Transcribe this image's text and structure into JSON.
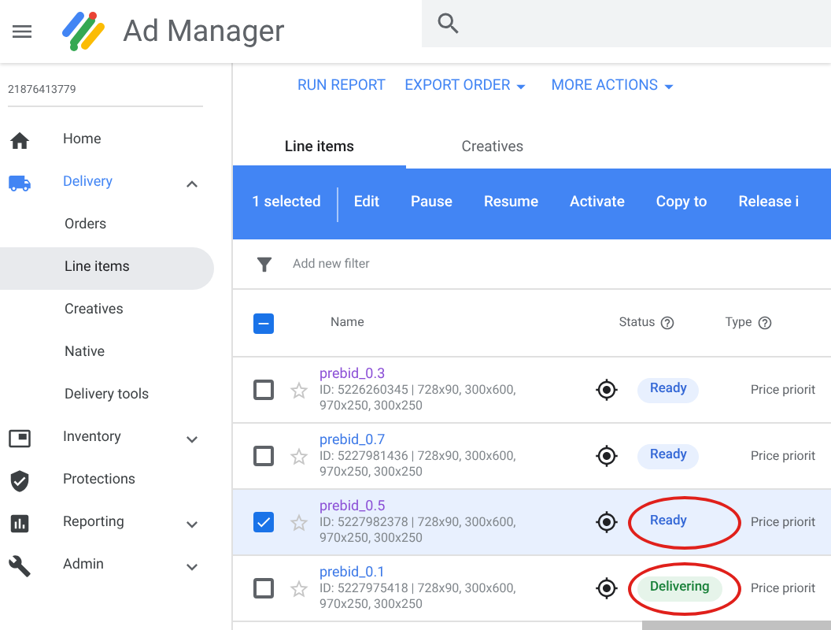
{
  "header": {
    "app_name": "Ad Manager"
  },
  "sidebar": {
    "account": "21876413779",
    "items": [
      {
        "label": "Home",
        "selected": false
      },
      {
        "label": "Delivery",
        "selected": true,
        "expanded": true,
        "children": [
          {
            "label": "Orders",
            "selected": false
          },
          {
            "label": "Line items",
            "selected": true
          },
          {
            "label": "Creatives",
            "selected": false
          },
          {
            "label": "Native",
            "selected": false
          },
          {
            "label": "Delivery tools",
            "selected": false
          }
        ]
      },
      {
        "label": "Inventory",
        "selected": false,
        "expanded": false
      },
      {
        "label": "Protections",
        "selected": false
      },
      {
        "label": "Reporting",
        "selected": false,
        "expanded": false
      },
      {
        "label": "Admin",
        "selected": false,
        "expanded": false
      }
    ]
  },
  "actions": [
    {
      "label": "RUN REPORT",
      "dropdown": false
    },
    {
      "label": "EXPORT ORDER",
      "dropdown": true
    },
    {
      "label": "MORE ACTIONS",
      "dropdown": true
    }
  ],
  "tabs": [
    {
      "label": "Line items",
      "selected": true
    },
    {
      "label": "Creatives",
      "selected": false
    }
  ],
  "selection_bar": {
    "count": "1 selected",
    "buttons": [
      "Edit",
      "Pause",
      "Resume",
      "Activate",
      "Copy to",
      "Release i"
    ]
  },
  "filter": {
    "placeholder": "Add new filter"
  },
  "table": {
    "select_all": {
      "indeterminate": true
    },
    "columns": [
      "Name",
      "Status",
      "Type"
    ],
    "rows": [
      {
        "name": "prebid_0.3",
        "visited": true,
        "details": "ID: 5226260345 | 728x90, 300x600, 970x250, 300x250",
        "checked": false,
        "status": {
          "label": "Ready",
          "kind": "ready",
          "annotated": false
        },
        "type": "Price priorit"
      },
      {
        "name": "prebid_0.7",
        "visited": false,
        "details": "ID: 5227981436 | 728x90, 300x600, 970x250, 300x250",
        "checked": false,
        "status": {
          "label": "Ready",
          "kind": "ready",
          "annotated": false
        },
        "type": "Price priorit"
      },
      {
        "name": "prebid_0.5",
        "visited": true,
        "details": "ID: 5227982378 | 728x90, 300x600, 970x250, 300x250",
        "checked": true,
        "status": {
          "label": "Ready",
          "kind": "ready",
          "annotated": true
        },
        "type": "Price priorit"
      },
      {
        "name": "prebid_0.1",
        "visited": false,
        "details": "ID: 5227975418 | 728x90, 300x600, 970x250, 300x250",
        "checked": false,
        "status": {
          "label": "Delivering",
          "kind": "delivering",
          "annotated": true
        },
        "type": "Price priorit"
      }
    ]
  }
}
